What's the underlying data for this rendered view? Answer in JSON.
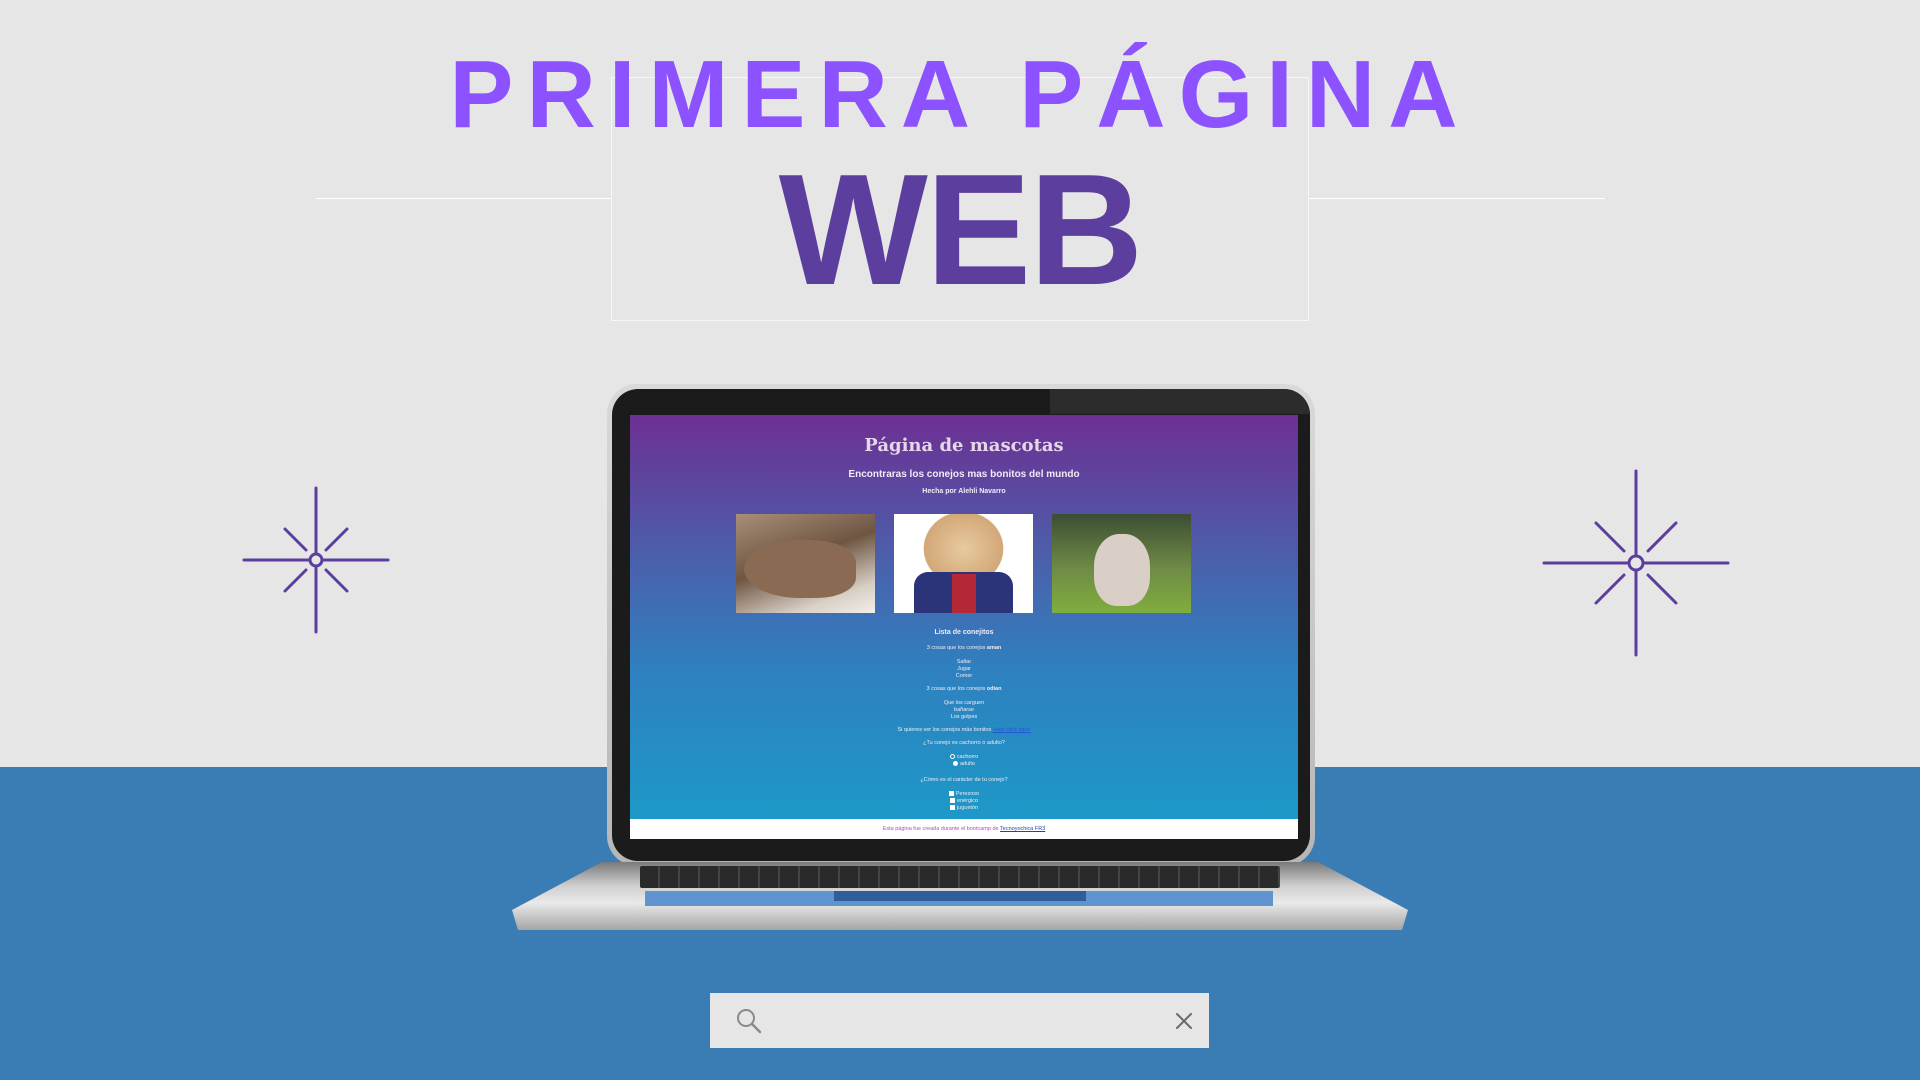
{
  "headline": {
    "line1": "PRIMERA PÁGINA",
    "line2": "WEB"
  },
  "colors": {
    "background": "#e7e6e6",
    "band": "#3a7db5",
    "headline1": "#8c52ff",
    "headline2": "#5c3e9e",
    "sparkle": "#5c3e9e"
  },
  "screen": {
    "title": "Página de mascotas",
    "subtitle": "Encontraras los conejos mas bonitos del mundo",
    "author": "Hecha por Alehli Navarro",
    "list_heading": "Lista de conejitos",
    "loves_intro": "3 cosas que los conejos ",
    "loves_bold": "aman",
    "loves": [
      "Saltar",
      "Jugar",
      "Comer"
    ],
    "hates_intro": "3 cosas que los conejos ",
    "hates_bold": "odian",
    "hates": [
      "Que los carguen",
      "bañarse",
      "Los golpes"
    ],
    "more_text": "Si quieres ver los conejos más bonitos ",
    "more_link": "¡Haz click aquí!",
    "q1": "¿Tu conejo es cachorro o adulto?",
    "q1_options": [
      "cachorro",
      "adulto"
    ],
    "q2": "¿Cómo es el carácter de tu conejo?",
    "q2_options": [
      "Perezoso",
      "enérgico",
      "juguetón"
    ],
    "footer_text": "Esta página fue creada durante el bootcamp de ",
    "footer_link": "Tecnoyochica FR3",
    "images": [
      "rabbit-photo",
      "puppy-in-suit-photo",
      "lop-rabbit-photo"
    ]
  },
  "search": {
    "placeholder": "",
    "value": "",
    "icon": "search-icon",
    "clear_icon": "close-icon"
  }
}
